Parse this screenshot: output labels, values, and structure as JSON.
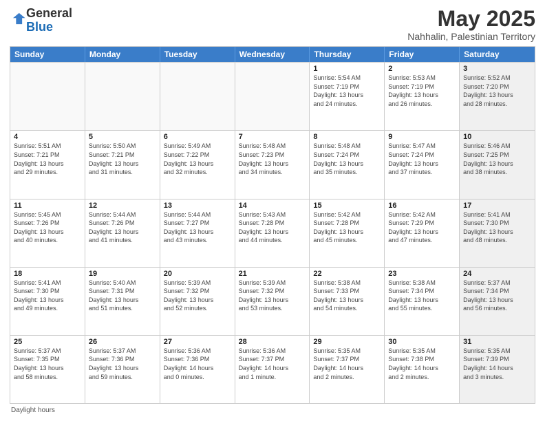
{
  "logo": {
    "general": "General",
    "blue": "Blue"
  },
  "header": {
    "title": "May 2025",
    "subtitle": "Nahhalin, Palestinian Territory"
  },
  "weekdays": [
    "Sunday",
    "Monday",
    "Tuesday",
    "Wednesday",
    "Thursday",
    "Friday",
    "Saturday"
  ],
  "footer": {
    "daylight_label": "Daylight hours"
  },
  "rows": [
    [
      {
        "day": "",
        "info": "",
        "empty": true
      },
      {
        "day": "",
        "info": "",
        "empty": true
      },
      {
        "day": "",
        "info": "",
        "empty": true
      },
      {
        "day": "",
        "info": "",
        "empty": true
      },
      {
        "day": "1",
        "info": "Sunrise: 5:54 AM\nSunset: 7:19 PM\nDaylight: 13 hours\nand 24 minutes."
      },
      {
        "day": "2",
        "info": "Sunrise: 5:53 AM\nSunset: 7:19 PM\nDaylight: 13 hours\nand 26 minutes."
      },
      {
        "day": "3",
        "info": "Sunrise: 5:52 AM\nSunset: 7:20 PM\nDaylight: 13 hours\nand 28 minutes.",
        "shaded": true
      }
    ],
    [
      {
        "day": "4",
        "info": "Sunrise: 5:51 AM\nSunset: 7:21 PM\nDaylight: 13 hours\nand 29 minutes."
      },
      {
        "day": "5",
        "info": "Sunrise: 5:50 AM\nSunset: 7:21 PM\nDaylight: 13 hours\nand 31 minutes."
      },
      {
        "day": "6",
        "info": "Sunrise: 5:49 AM\nSunset: 7:22 PM\nDaylight: 13 hours\nand 32 minutes."
      },
      {
        "day": "7",
        "info": "Sunrise: 5:48 AM\nSunset: 7:23 PM\nDaylight: 13 hours\nand 34 minutes."
      },
      {
        "day": "8",
        "info": "Sunrise: 5:48 AM\nSunset: 7:24 PM\nDaylight: 13 hours\nand 35 minutes."
      },
      {
        "day": "9",
        "info": "Sunrise: 5:47 AM\nSunset: 7:24 PM\nDaylight: 13 hours\nand 37 minutes."
      },
      {
        "day": "10",
        "info": "Sunrise: 5:46 AM\nSunset: 7:25 PM\nDaylight: 13 hours\nand 38 minutes.",
        "shaded": true
      }
    ],
    [
      {
        "day": "11",
        "info": "Sunrise: 5:45 AM\nSunset: 7:26 PM\nDaylight: 13 hours\nand 40 minutes."
      },
      {
        "day": "12",
        "info": "Sunrise: 5:44 AM\nSunset: 7:26 PM\nDaylight: 13 hours\nand 41 minutes."
      },
      {
        "day": "13",
        "info": "Sunrise: 5:44 AM\nSunset: 7:27 PM\nDaylight: 13 hours\nand 43 minutes."
      },
      {
        "day": "14",
        "info": "Sunrise: 5:43 AM\nSunset: 7:28 PM\nDaylight: 13 hours\nand 44 minutes."
      },
      {
        "day": "15",
        "info": "Sunrise: 5:42 AM\nSunset: 7:28 PM\nDaylight: 13 hours\nand 45 minutes."
      },
      {
        "day": "16",
        "info": "Sunrise: 5:42 AM\nSunset: 7:29 PM\nDaylight: 13 hours\nand 47 minutes."
      },
      {
        "day": "17",
        "info": "Sunrise: 5:41 AM\nSunset: 7:30 PM\nDaylight: 13 hours\nand 48 minutes.",
        "shaded": true
      }
    ],
    [
      {
        "day": "18",
        "info": "Sunrise: 5:41 AM\nSunset: 7:30 PM\nDaylight: 13 hours\nand 49 minutes."
      },
      {
        "day": "19",
        "info": "Sunrise: 5:40 AM\nSunset: 7:31 PM\nDaylight: 13 hours\nand 51 minutes."
      },
      {
        "day": "20",
        "info": "Sunrise: 5:39 AM\nSunset: 7:32 PM\nDaylight: 13 hours\nand 52 minutes."
      },
      {
        "day": "21",
        "info": "Sunrise: 5:39 AM\nSunset: 7:32 PM\nDaylight: 13 hours\nand 53 minutes."
      },
      {
        "day": "22",
        "info": "Sunrise: 5:38 AM\nSunset: 7:33 PM\nDaylight: 13 hours\nand 54 minutes."
      },
      {
        "day": "23",
        "info": "Sunrise: 5:38 AM\nSunset: 7:34 PM\nDaylight: 13 hours\nand 55 minutes."
      },
      {
        "day": "24",
        "info": "Sunrise: 5:37 AM\nSunset: 7:34 PM\nDaylight: 13 hours\nand 56 minutes.",
        "shaded": true
      }
    ],
    [
      {
        "day": "25",
        "info": "Sunrise: 5:37 AM\nSunset: 7:35 PM\nDaylight: 13 hours\nand 58 minutes."
      },
      {
        "day": "26",
        "info": "Sunrise: 5:37 AM\nSunset: 7:36 PM\nDaylight: 13 hours\nand 59 minutes."
      },
      {
        "day": "27",
        "info": "Sunrise: 5:36 AM\nSunset: 7:36 PM\nDaylight: 14 hours\nand 0 minutes."
      },
      {
        "day": "28",
        "info": "Sunrise: 5:36 AM\nSunset: 7:37 PM\nDaylight: 14 hours\nand 1 minute."
      },
      {
        "day": "29",
        "info": "Sunrise: 5:35 AM\nSunset: 7:37 PM\nDaylight: 14 hours\nand 2 minutes."
      },
      {
        "day": "30",
        "info": "Sunrise: 5:35 AM\nSunset: 7:38 PM\nDaylight: 14 hours\nand 2 minutes."
      },
      {
        "day": "31",
        "info": "Sunrise: 5:35 AM\nSunset: 7:39 PM\nDaylight: 14 hours\nand 3 minutes.",
        "shaded": true
      }
    ]
  ]
}
